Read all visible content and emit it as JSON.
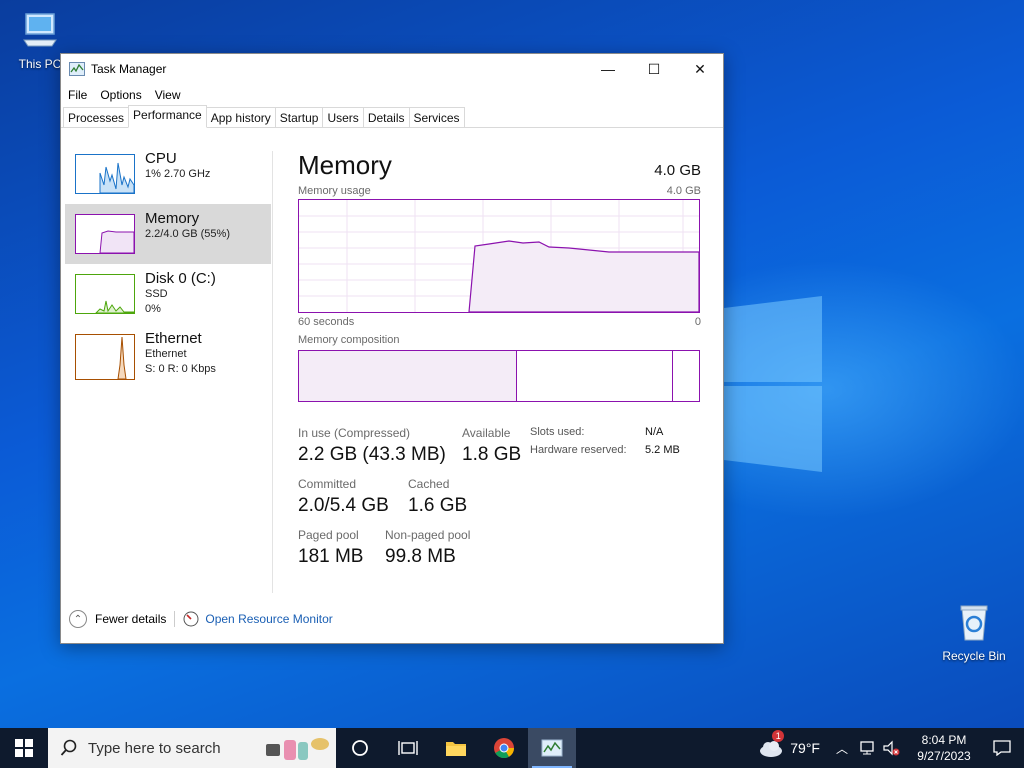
{
  "desktop": {
    "icons": [
      {
        "label": "This PC",
        "icon": "computer-icon"
      },
      {
        "label": "Recycle Bin",
        "icon": "recycle-bin-icon"
      }
    ]
  },
  "window": {
    "title": "Task Manager",
    "controls": {
      "minimize": "—",
      "maximize": "☐",
      "close": "✕"
    },
    "menu": [
      "File",
      "Options",
      "View"
    ],
    "tabs": [
      "Processes",
      "Performance",
      "App history",
      "Startup",
      "Users",
      "Details",
      "Services"
    ],
    "active_tab": "Performance"
  },
  "sidebar": {
    "items": [
      {
        "name": "CPU",
        "line2": "1% 2.70 GHz",
        "line3": "",
        "color": "#1a73c8"
      },
      {
        "name": "Memory",
        "line2": "2.2/4.0 GB (55%)",
        "line3": "",
        "color": "#8b12ae"
      },
      {
        "name": "Disk 0 (C:)",
        "line2": "SSD",
        "line3": "0%",
        "color": "#4da60c"
      },
      {
        "name": "Ethernet",
        "line2": "Ethernet",
        "line3": "S: 0 R: 0 Kbps",
        "color": "#a74f01"
      }
    ]
  },
  "memory": {
    "title": "Memory",
    "total": "4.0 GB",
    "usage_label": "Memory usage",
    "usage_max": "4.0 GB",
    "axis_left": "60 seconds",
    "axis_right": "0",
    "composition_label": "Memory composition",
    "stats": {
      "in_use_label": "In use (Compressed)",
      "in_use_value": "2.2 GB (43.3 MB)",
      "available_label": "Available",
      "available_value": "1.8 GB",
      "committed_label": "Committed",
      "committed_value": "2.0/5.4 GB",
      "cached_label": "Cached",
      "cached_value": "1.6 GB",
      "paged_label": "Paged pool",
      "paged_value": "181 MB",
      "nonpaged_label": "Non-paged pool",
      "nonpaged_value": "99.8 MB",
      "slots_label": "Slots used:",
      "slots_value": "N/A",
      "hw_label": "Hardware reserved:",
      "hw_value": "5.2 MB"
    }
  },
  "footer": {
    "fewer_details": "Fewer details",
    "open_monitor": "Open Resource Monitor"
  },
  "taskbar": {
    "search_placeholder": "Type here to search",
    "weather": "79°F",
    "weather_badge": "1",
    "time": "8:04 PM",
    "date": "9/27/2023"
  },
  "colors": {
    "memory_accent": "#8b12ae",
    "taskbar_bg": "#0e1a2d",
    "link": "#1a5fb4"
  }
}
